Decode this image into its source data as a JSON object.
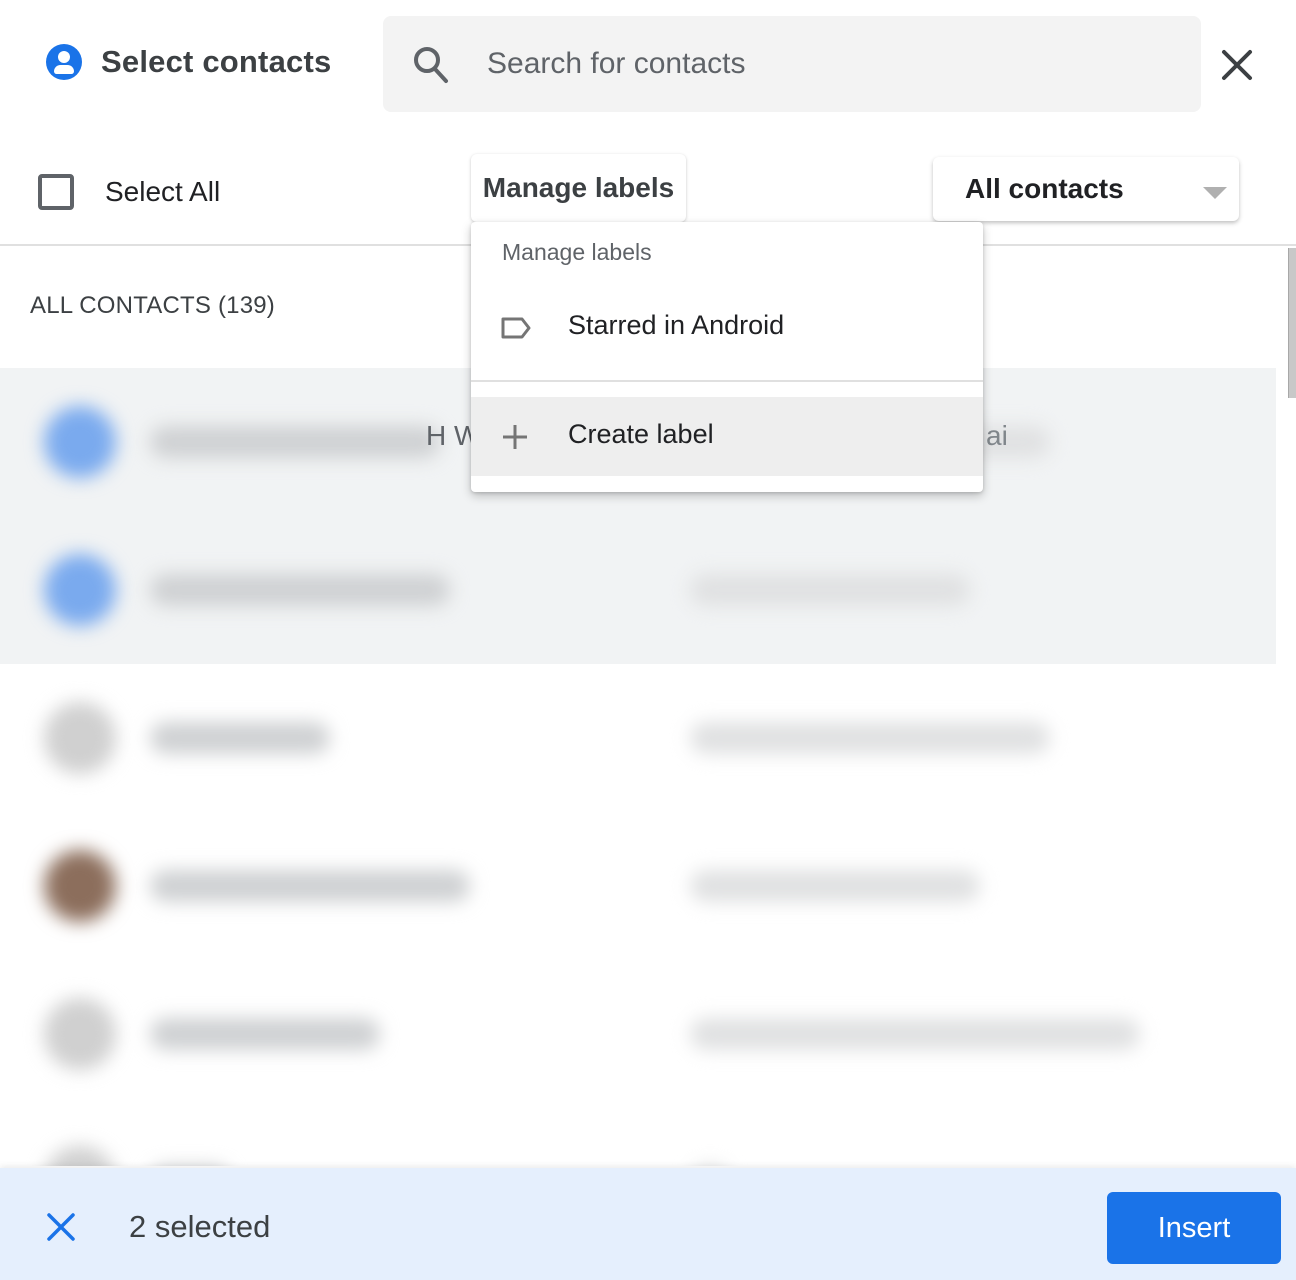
{
  "header": {
    "title": "Select contacts",
    "search_placeholder": "Search for contacts",
    "search_value": "",
    "close_label": "Close"
  },
  "toolbar": {
    "select_all_label": "Select All",
    "select_all_checked": false,
    "manage_labels_label": "Manage labels",
    "filter_value": "All contacts"
  },
  "list": {
    "section_heading": "ALL CONTACTS (139)",
    "rows": [
      {
        "name": "[redacted]",
        "email": "[redacted]",
        "selected": true,
        "avatar_color": "#7aaaee"
      },
      {
        "name": "[redacted]",
        "email": "[redacted]",
        "selected": true,
        "avatar_color": "#7aaaee"
      },
      {
        "name": "[redacted]",
        "email": "[redacted]",
        "selected": false,
        "avatar_color": "#d0d0d0"
      },
      {
        "name": "[redacted]",
        "email": "[redacted]",
        "selected": false,
        "avatar_color": "#8c6e5c"
      },
      {
        "name": "[redacted]",
        "email": "[redacted]",
        "selected": false,
        "avatar_color": "#d0d0d0"
      },
      {
        "name": "[redacted]",
        "email": "[redacted]",
        "selected": false,
        "avatar_color": "#d0d0d0"
      }
    ],
    "visible_fragments": {
      "row1_name_tail": "H W",
      "row1_email_tail": "ai"
    }
  },
  "menu": {
    "header": "Manage labels",
    "items": [
      {
        "label": "Starred in Android",
        "icon": "label-icon"
      },
      {
        "label": "Create label",
        "icon": "plus-icon"
      }
    ]
  },
  "bottom_bar": {
    "selected_count": "2 selected",
    "insert_label": "Insert"
  },
  "colors": {
    "accent": "#1a73e8",
    "bottom_bar_bg": "#e5effd",
    "search_bg": "#f3f3f3",
    "selected_row_bg": "#f1f3f4"
  }
}
